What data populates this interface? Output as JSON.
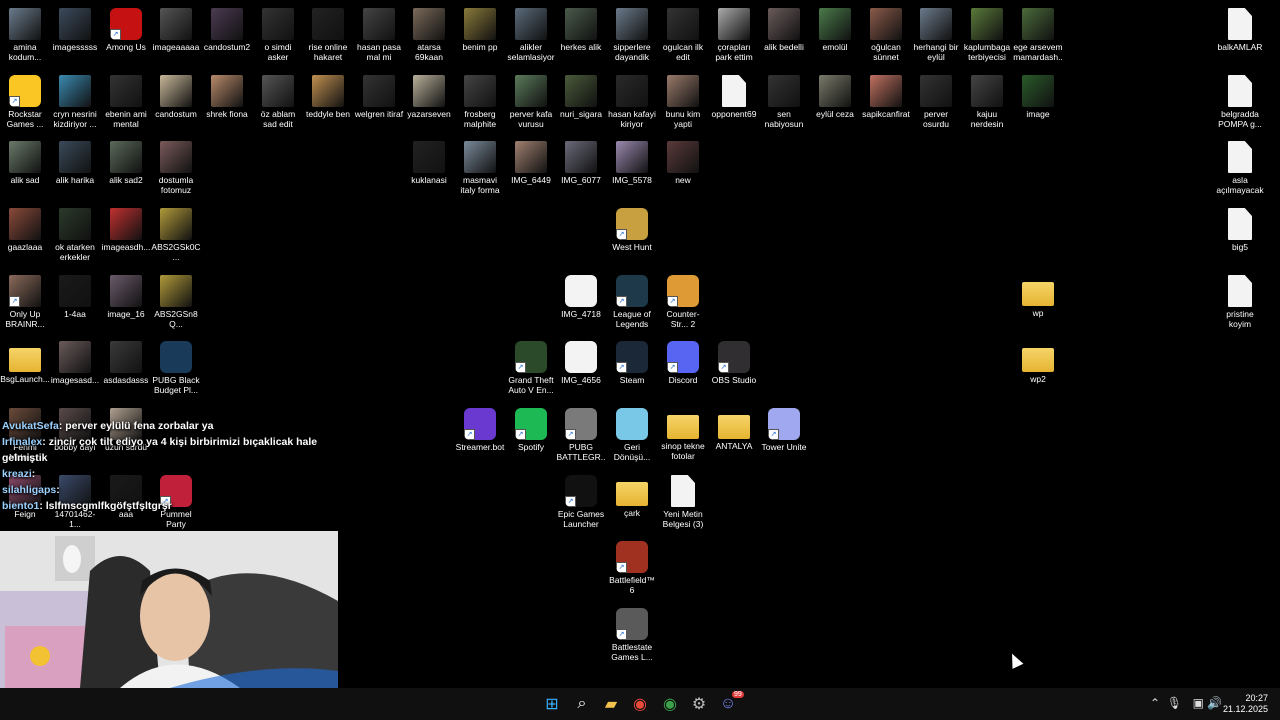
{
  "desktop_icons": [
    {
      "label": "amina kodum...",
      "kind": "img",
      "color": "#6a7b8c",
      "icon": "image-icon"
    },
    {
      "label": "imagesssss",
      "kind": "img",
      "color": "#3b4a5c",
      "icon": "image-icon"
    },
    {
      "label": "Among Us",
      "kind": "app",
      "color": "#c51111",
      "icon": "among-us-icon",
      "shortcut": true
    },
    {
      "label": "imageaaaaa",
      "kind": "img",
      "color": "#555",
      "icon": "image-icon"
    },
    {
      "label": "candostum2",
      "kind": "img",
      "color": "#4c3b52",
      "icon": "image-icon"
    },
    {
      "label": "o simdi asker",
      "kind": "img",
      "color": "#333",
      "icon": "image-icon"
    },
    {
      "label": "rise online hakaret",
      "kind": "img",
      "color": "#222",
      "icon": "image-icon"
    },
    {
      "label": "hasan pasa mal mi",
      "kind": "img",
      "color": "#444",
      "icon": "image-icon"
    },
    {
      "label": "atarsa 69kaan",
      "kind": "img",
      "color": "#7b6a5a",
      "icon": "image-icon"
    },
    {
      "label": "benim pp",
      "kind": "img",
      "color": "#8a7a3a",
      "icon": "image-icon"
    },
    {
      "label": "alikler selamlasiyor",
      "kind": "img",
      "color": "#5a6a7a",
      "icon": "image-icon"
    },
    {
      "label": "herkes alik",
      "kind": "img",
      "color": "#4a5a4a",
      "icon": "image-icon"
    },
    {
      "label": "sipperlere dayandik",
      "kind": "img",
      "color": "#6a7a8a",
      "icon": "image-icon"
    },
    {
      "label": "ogulcan ilk edit",
      "kind": "img",
      "color": "#333",
      "icon": "video-icon"
    },
    {
      "label": "çorapları park ettim",
      "kind": "img",
      "color": "#aaa",
      "icon": "image-icon"
    },
    {
      "label": "alik bedelli",
      "kind": "img",
      "color": "#6a5a5a",
      "icon": "image-icon"
    },
    {
      "label": "emolül",
      "kind": "img",
      "color": "#4a7a4a",
      "icon": "image-icon"
    },
    {
      "label": "oğulcan sünnet",
      "kind": "img",
      "color": "#8a5a4a",
      "icon": "image-icon"
    },
    {
      "label": "herhangi bir eylül",
      "kind": "img",
      "color": "#6a7a8a",
      "icon": "image-icon"
    },
    {
      "label": "kaplumbaga terbiyecisi",
      "kind": "img",
      "color": "#5a7a3a",
      "icon": "image-icon"
    },
    {
      "label": "ege arsevem mamardash...",
      "kind": "img",
      "color": "#4a6a3a",
      "icon": "image-icon"
    },
    {
      "label": "balkAMLAR",
      "kind": "file",
      "color": "#f3f3f3",
      "icon": "file-icon"
    },
    {
      "label": "Rockstar Games ...",
      "kind": "app",
      "color": "#f9c623",
      "icon": "rockstar-icon",
      "shortcut": true
    },
    {
      "label": "cryn nesrini kizdiriyor ...",
      "kind": "img",
      "color": "#3a8ab0",
      "icon": "video-icon"
    },
    {
      "label": "ebenin ami mental",
      "kind": "img",
      "color": "#333",
      "icon": "video-icon"
    },
    {
      "label": "candostum",
      "kind": "img",
      "color": "#c8b89a",
      "icon": "image-icon"
    },
    {
      "label": "shrek fiona",
      "kind": "img",
      "color": "#b88a6a",
      "icon": "image-icon"
    },
    {
      "label": "öz ablam sad edit",
      "kind": "img",
      "color": "#555",
      "icon": "video-icon"
    },
    {
      "label": "teddyle ben",
      "kind": "img",
      "color": "#c09050",
      "icon": "image-icon"
    },
    {
      "label": "welgren itiraf",
      "kind": "img",
      "color": "#333",
      "icon": "video-icon"
    },
    {
      "label": "yazarseven",
      "kind": "img",
      "color": "#b8b09a",
      "icon": "image-icon"
    },
    {
      "label": "frosberg malphite",
      "kind": "img",
      "color": "#444",
      "icon": "video-icon"
    },
    {
      "label": "perver kafa vurusu",
      "kind": "img",
      "color": "#5a7a5a",
      "icon": "image-icon"
    },
    {
      "label": "nuri_sigara",
      "kind": "img",
      "color": "#4a5a3a",
      "icon": "image-icon"
    },
    {
      "label": "hasan kafayi kiriyor",
      "kind": "img",
      "color": "#2a2a2a",
      "icon": "image-icon"
    },
    {
      "label": "bunu kim yapti",
      "kind": "img",
      "color": "#9a7a6a",
      "icon": "image-icon"
    },
    {
      "label": "opponent69",
      "kind": "file",
      "color": "#f3f3f3",
      "icon": "file-icon"
    },
    {
      "label": "sen nabiyosun ya",
      "kind": "img",
      "color": "#333",
      "icon": "video-icon"
    },
    {
      "label": "eylül ceza",
      "kind": "img",
      "color": "#7a7a6a",
      "icon": "image-icon"
    },
    {
      "label": "sapikcanfirat",
      "kind": "img",
      "color": "#c07060",
      "icon": "image-icon"
    },
    {
      "label": "perver osurdu",
      "kind": "img",
      "color": "#333",
      "icon": "video-icon"
    },
    {
      "label": "kajuu nerdesin",
      "kind": "img",
      "color": "#444",
      "icon": "video-icon"
    },
    {
      "label": "image",
      "kind": "img",
      "color": "#2a5a2a",
      "icon": "image-icon"
    },
    {
      "label": "belgradda POMPA g...",
      "kind": "file",
      "color": "#f3f3f3",
      "icon": "file-icon"
    },
    {
      "label": "alik sad",
      "kind": "img",
      "color": "#6a7a6a",
      "icon": "image-icon"
    },
    {
      "label": "alik harika",
      "kind": "img",
      "color": "#3a4a5a",
      "icon": "image-icon"
    },
    {
      "label": "alik sad2",
      "kind": "img",
      "color": "#5a6a5a",
      "icon": "image-icon"
    },
    {
      "label": "dostumla fotomuz",
      "kind": "img",
      "color": "#7a5a5a",
      "icon": "image-icon"
    },
    {
      "label": "kuklanasi",
      "kind": "img",
      "color": "#222",
      "icon": "image-icon"
    },
    {
      "label": "masmavi italy forma",
      "kind": "img",
      "color": "#7a8a9a",
      "icon": "image-icon"
    },
    {
      "label": "IMG_6449",
      "kind": "img",
      "color": "#a08070",
      "icon": "image-icon"
    },
    {
      "label": "IMG_6077",
      "kind": "img",
      "color": "#6a6a7a",
      "icon": "image-icon"
    },
    {
      "label": "IMG_5578",
      "kind": "img",
      "color": "#9a8ab0",
      "icon": "image-icon"
    },
    {
      "label": "new",
      "kind": "img",
      "color": "#5a3a3a",
      "icon": "image-icon"
    },
    {
      "label": "asla açılmayacak",
      "kind": "file",
      "color": "#f3f3f3",
      "icon": "file-icon"
    },
    {
      "label": "gaazlaaa",
      "kind": "img",
      "color": "#8a4a3a",
      "icon": "image-icon"
    },
    {
      "label": "ok atarken erkekler",
      "kind": "img",
      "color": "#2a3a2a",
      "icon": "image-icon"
    },
    {
      "label": "imageasdh...",
      "kind": "img",
      "color": "#c03030",
      "icon": "image-icon"
    },
    {
      "label": "ABS2GSk0C...",
      "kind": "img",
      "color": "#b09a3a",
      "icon": "image-icon"
    },
    {
      "label": "West Hunt",
      "kind": "app",
      "color": "#c8a040",
      "icon": "sheriff-star-icon",
      "shortcut": true
    },
    {
      "label": "big5",
      "kind": "file",
      "color": "#f3f3f3",
      "icon": "file-icon"
    },
    {
      "label": "Only Up BRAINR...",
      "kind": "img",
      "color": "#8a6a5a",
      "icon": "image-icon",
      "shortcut": true
    },
    {
      "label": "1-4aa",
      "kind": "img",
      "color": "#1a1a1a",
      "icon": "image-icon"
    },
    {
      "label": "image_16",
      "kind": "img",
      "color": "#6a5a6a",
      "icon": "image-icon"
    },
    {
      "label": "ABS2GSn8Q...",
      "kind": "img",
      "color": "#b09a3a",
      "icon": "image-icon"
    },
    {
      "label": "IMG_4718",
      "kind": "app",
      "color": "#f3f3f3",
      "icon": "video-player-icon"
    },
    {
      "label": "League of Legends",
      "kind": "app",
      "color": "#1e3a4a",
      "icon": "league-of-legends-icon",
      "shortcut": true
    },
    {
      "label": "Counter-Str... 2",
      "kind": "app",
      "color": "#de9b35",
      "icon": "counter-strike-icon",
      "shortcut": true
    },
    {
      "label": "wp",
      "kind": "folder",
      "color": "#e5b431",
      "icon": "folder-icon"
    },
    {
      "label": "pristine koyim",
      "kind": "file",
      "color": "#f3f3f3",
      "icon": "file-icon"
    },
    {
      "label": "BsgLaunch...",
      "kind": "folder",
      "color": "#e5b431",
      "icon": "folder-icon"
    },
    {
      "label": "imagesasd...",
      "kind": "img",
      "color": "#6a5a5a",
      "icon": "image-icon"
    },
    {
      "label": "asdasdasss",
      "kind": "img",
      "color": "#3a3a3a",
      "icon": "image-icon"
    },
    {
      "label": "PUBG Black Budget Pl...",
      "kind": "app",
      "color": "#1a3a5a",
      "icon": "pubg-black-budget-icon"
    },
    {
      "label": "Grand Theft Auto V En...",
      "kind": "app",
      "color": "#2a4a2a",
      "icon": "gta-v-icon",
      "shortcut": true
    },
    {
      "label": "IMG_4656",
      "kind": "app",
      "color": "#f3f3f3",
      "icon": "video-player-icon"
    },
    {
      "label": "Steam",
      "kind": "app",
      "color": "#1b2838",
      "icon": "steam-icon",
      "shortcut": true
    },
    {
      "label": "Discord",
      "kind": "app",
      "color": "#5865f2",
      "icon": "discord-icon",
      "shortcut": true
    },
    {
      "label": "OBS Studio",
      "kind": "app",
      "color": "#302e31",
      "icon": "obs-icon",
      "shortcut": true
    },
    {
      "label": "wp2",
      "kind": "folder",
      "color": "#e5b431",
      "icon": "folder-icon"
    },
    {
      "label": "Streamer.bot",
      "kind": "app",
      "color": "#6a3ad0",
      "icon": "streamerbot-icon",
      "shortcut": true
    },
    {
      "label": "Spotify",
      "kind": "app",
      "color": "#1db954",
      "icon": "spotify-icon",
      "shortcut": true
    },
    {
      "label": "PUBG BATTLEGR...",
      "kind": "app",
      "color": "#7a7a7a",
      "icon": "pubg-icon",
      "shortcut": true
    },
    {
      "label": "Geri Dönüşü...",
      "kind": "app",
      "color": "#7ac8e8",
      "icon": "recycle-bin-icon"
    },
    {
      "label": "sinop tekne fotolar",
      "kind": "folder",
      "color": "#e5b431",
      "icon": "folder-icon"
    },
    {
      "label": "ANTALYA",
      "kind": "folder",
      "color": "#e5b431",
      "icon": "folder-icon"
    },
    {
      "label": "Tower Unite",
      "kind": "app",
      "color": "#a0a8f0",
      "icon": "tower-unite-icon",
      "shortcut": true
    },
    {
      "label": "Fehmi Midnig...",
      "kind": "img",
      "color": "#6a4a3a",
      "icon": "image-icon"
    },
    {
      "label": "bobby dayı",
      "kind": "img",
      "color": "#5a4a4a",
      "icon": "image-icon"
    },
    {
      "label": "uzun sürdü",
      "kind": "img",
      "color": "#b0a090",
      "icon": "image-icon"
    },
    {
      "label": "Feign",
      "kind": "img",
      "color": "#8a4a6a",
      "icon": "image-icon"
    },
    {
      "label": "14701462-1...",
      "kind": "img",
      "color": "#3a4a6a",
      "icon": "image-icon"
    },
    {
      "label": "aaa",
      "kind": "img",
      "color": "#1a1a1a",
      "icon": "image-icon"
    },
    {
      "label": "Pummel Party",
      "kind": "app",
      "color": "#c0203a",
      "icon": "pummel-party-icon",
      "shortcut": true
    },
    {
      "label": "Epic Games Launcher",
      "kind": "app",
      "color": "#111",
      "icon": "epic-games-icon",
      "shortcut": true
    },
    {
      "label": "çark",
      "kind": "folder",
      "color": "#e5b431",
      "icon": "folder-icon"
    },
    {
      "label": "Yeni Metin Belgesi (3)",
      "kind": "file",
      "color": "#f3f3f3",
      "icon": "file-icon"
    },
    {
      "label": "Battlefield™ 6",
      "kind": "app",
      "color": "#a03020",
      "icon": "battlefield-icon",
      "shortcut": true
    },
    {
      "label": "Battlestate Games L...",
      "kind": "app",
      "color": "#5a5a5a",
      "icon": "battlestate-icon",
      "shortcut": true
    }
  ],
  "chat": [
    {
      "user": "AvukatSefa",
      "text": ": perver eylülü fena zorbalar ya"
    },
    {
      "user": "Irfinalex",
      "text": ": zincir çok tilt ediyo ya 4 kişi birbirimizi bıçaklicak hale gelmiştik"
    },
    {
      "user": "kreazi",
      "text": ":"
    },
    {
      "user": "silahligaps",
      "text": ":"
    },
    {
      "user": "biento1",
      "text": ": lslfmscgmlfkgöfştfşltgrşr"
    }
  ],
  "taskbar": {
    "items": [
      {
        "name": "start-button",
        "glyph": "⊞",
        "color": "#3ab0ff"
      },
      {
        "name": "search-button",
        "glyph": "⌕",
        "color": "#fff"
      },
      {
        "name": "file-explorer-button",
        "glyph": "▰",
        "color": "#f2c14e"
      },
      {
        "name": "chrome-button",
        "glyph": "◉",
        "color": "#e84a3a"
      },
      {
        "name": "chrome-profile-button",
        "glyph": "◉",
        "color": "#3aa34a"
      },
      {
        "name": "steam-taskbar-button",
        "glyph": "⚙",
        "color": "#bbb"
      },
      {
        "name": "discord-taskbar-button",
        "glyph": "☺",
        "color": "#7984f5"
      }
    ],
    "discord_badge": "99",
    "time": "20:27",
    "date": "21.12.2025"
  }
}
